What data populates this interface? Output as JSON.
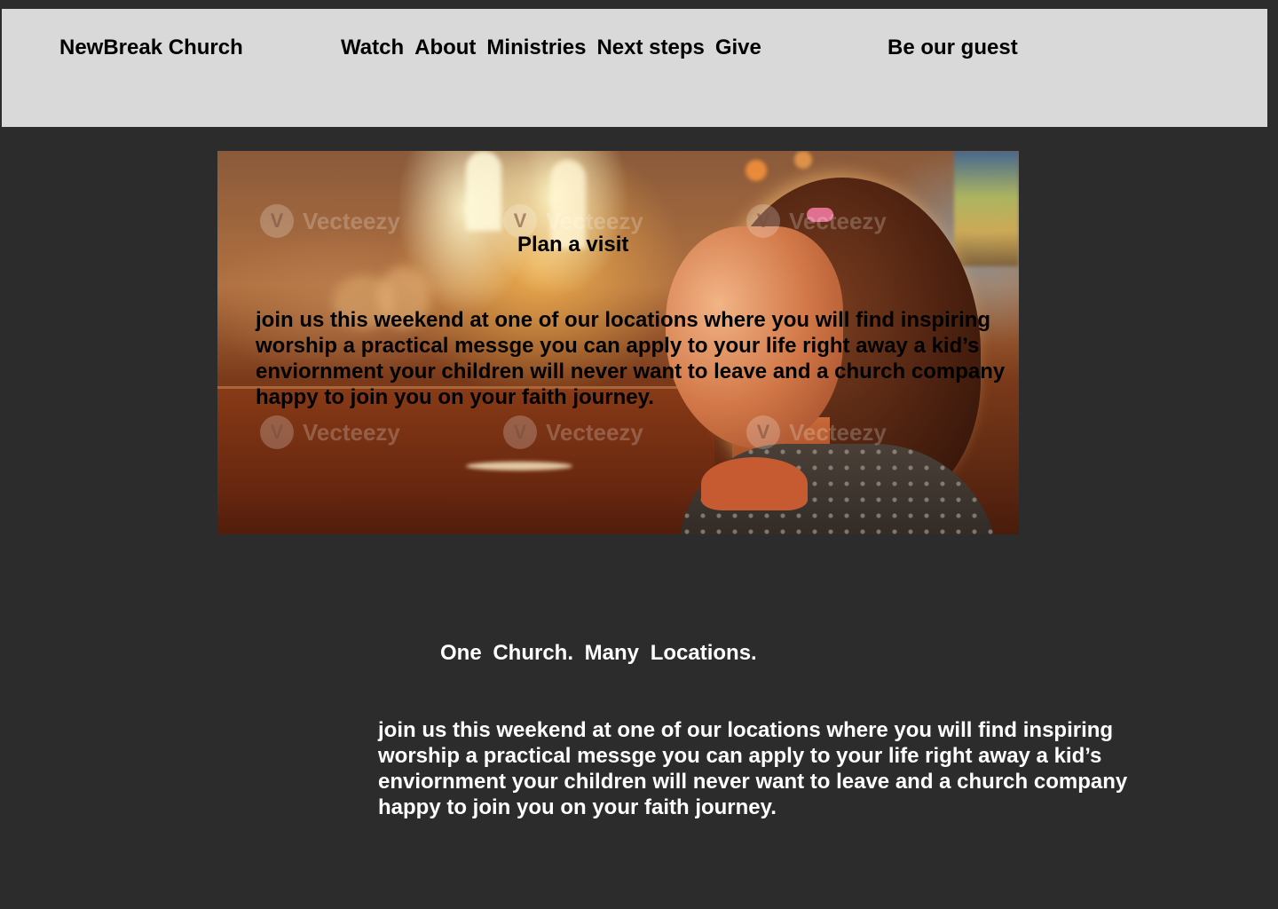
{
  "header": {
    "brand": "NewBreak Church",
    "nav": [
      "Watch",
      "About",
      "Ministries",
      "Next steps",
      "Give"
    ],
    "cta": "Be our guest"
  },
  "hero": {
    "title": "Plan a visit",
    "body": "join us this weekend at one of our locations where you will find inspiring worship a practical messge you can apply to your life right away a kid’s enviornment your children will never want to leave and a church company happy to join you on your faith journey.",
    "watermark": "Vecteezy",
    "watermark_logo": "V"
  },
  "locations": {
    "title": "One  Church.  Many  Locations.",
    "body": "join us this weekend at one of our locations where you will find inspiring worship a practical messge you can apply to your life right away a kid’s enviornment your children will never want to leave and a church company happy to join you on your faith journey."
  },
  "colors": {
    "page_background": "#2c2c2c",
    "navbar_background": "#d9d9d9",
    "nav_text": "#000000",
    "section_text": "#ffffff"
  }
}
